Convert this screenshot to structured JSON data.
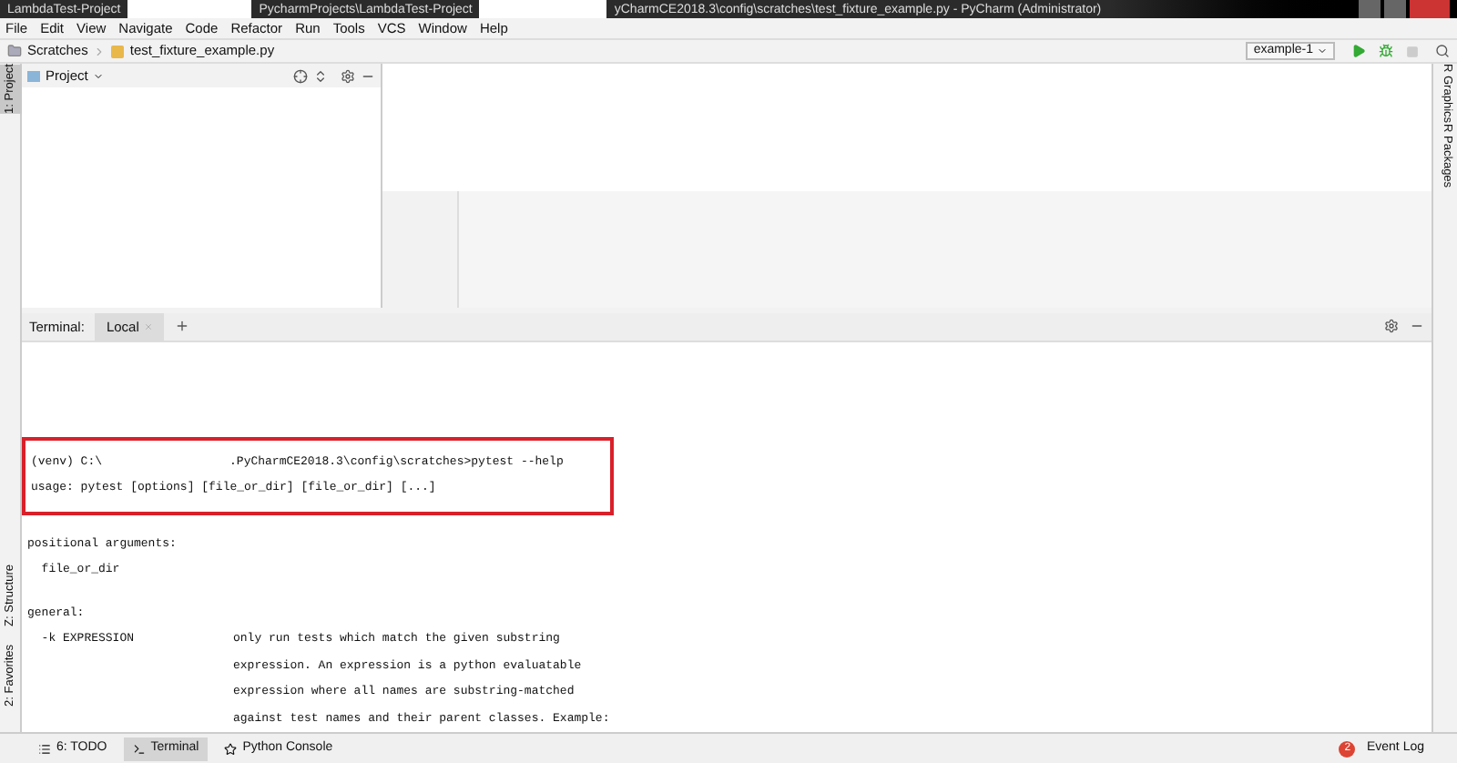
{
  "title_bar": {
    "segments": [
      "LambdaTest-Project",
      "PycharmProjects\\LambdaTest-Project",
      "yCharmCE2018.3\\config\\scratches\\test_fixture_example.py - PyCharm (Administrator)"
    ]
  },
  "menu": [
    "File",
    "Edit",
    "View",
    "Navigate",
    "Code",
    "Refactor",
    "Run",
    "Tools",
    "VCS",
    "Window",
    "Help"
  ],
  "breadcrumb": [
    "Scratches",
    "test_fixture_example.py"
  ],
  "run_config": "example-1",
  "left_stripe": [
    {
      "label": "1: Project",
      "selected": true
    },
    {
      "label": "Z: Structure",
      "selected": false
    },
    {
      "label": "2: Favorites",
      "selected": false
    }
  ],
  "right_stripe": [
    "R Graphics",
    "R Packages"
  ],
  "project_panel": {
    "title": "Project"
  },
  "terminal": {
    "label": "Terminal:",
    "tabs": [
      {
        "label": "Local",
        "selected": true
      }
    ],
    "lines": [
      {
        "kind": "prompt",
        "prefix": "(venv) C:\\",
        "command": ".PyCharmCE2018.3\\config\\scratches>pytest --help"
      },
      {
        "kind": "text",
        "text": "usage: pytest [options] [file_or_dir] [file_or_dir] [...]"
      },
      {
        "kind": "blank"
      },
      {
        "kind": "text",
        "text": "positional arguments:"
      },
      {
        "kind": "text",
        "text": "  file_or_dir"
      },
      {
        "kind": "blank"
      },
      {
        "kind": "text",
        "text": "general:"
      },
      {
        "kind": "option",
        "option": "  -k EXPRESSION",
        "description": "only run tests which match the given substring"
      },
      {
        "kind": "option",
        "description": "expression. An expression is a python evaluatable"
      },
      {
        "kind": "option",
        "description": "expression where all names are substring-matched"
      },
      {
        "kind": "option",
        "description": "against test names and their parent classes. Example:"
      }
    ]
  },
  "bottom_tabs": [
    {
      "label": "6: TODO",
      "selected": false
    },
    {
      "label": "Terminal",
      "selected": true
    },
    {
      "label": "Python Console",
      "selected": false
    }
  ],
  "event_log": {
    "label": "Event Log",
    "badge": "2"
  }
}
